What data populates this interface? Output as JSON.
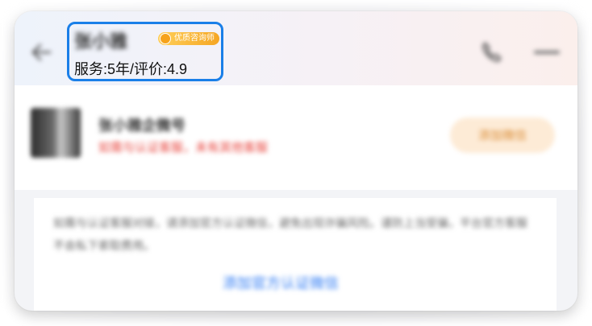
{
  "header": {
    "name": "张小雅",
    "badge": "优质咨询师",
    "subtitle": "服务:5年/评价:4.9"
  },
  "card": {
    "title": "张小雅企微号",
    "warning": "如需与认证客服，未有其他客服",
    "add_button": "添加微信"
  },
  "notice": {
    "text": "如需与认证客服对接，请添加官方认证微信，避免出现诈骗风险。谨防上当受骗，平台官方客服不会私下索取费用。",
    "link": "添加官方认证微信"
  },
  "colors": {
    "accent": "#1a7fe8",
    "warning": "#e8413a",
    "link": "#2f7bf4",
    "button_bg": "#fdebd6"
  }
}
